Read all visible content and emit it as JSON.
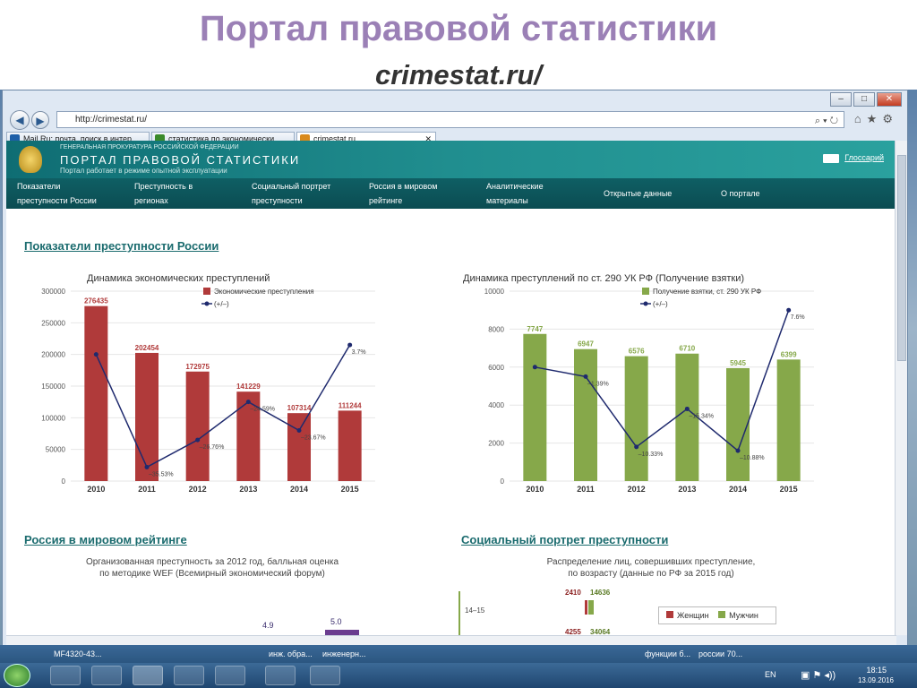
{
  "slide": {
    "title": "Портал правовой статистики",
    "subtitle": "crimestat.ru/"
  },
  "browser": {
    "address": "http://crimestat.ru/",
    "tabs": [
      {
        "label": "Mail.Ru: почта, поиск в интер...",
        "icon_color": "#1e5fa8"
      },
      {
        "label": "статистика по экономически...",
        "icon_color": "#3a8a2a"
      },
      {
        "label": "crimestat.ru",
        "icon_color": "#d98a1c"
      }
    ],
    "tab_close": "✕",
    "window_buttons": [
      "–",
      "□",
      "✕"
    ]
  },
  "portal": {
    "org": "ГЕНЕРАЛЬНАЯ ПРОКУРАТУРА РОССИЙСКОЙ ФЕДЕРАЦИИ",
    "name": "ПОРТАЛ ПРАВОВОЙ СТАТИСТИКИ",
    "note": "Портал работает в режиме опытной эксплуатации",
    "glossary": "Глоссарий",
    "menu": [
      {
        "line1": "Показатели",
        "line2": "преступности России"
      },
      {
        "line1": "Преступность в",
        "line2": "регионах"
      },
      {
        "line1": "Социальный портрет",
        "line2": "преступности"
      },
      {
        "line1": "Россия в мировом",
        "line2": "рейтинге"
      },
      {
        "line1": "Аналитические",
        "line2": "материалы"
      },
      {
        "line1": "Открытые данные",
        "line2": ""
      },
      {
        "line1": "О портале",
        "line2": ""
      }
    ]
  },
  "sections": {
    "indicators": "Показатели преступности России",
    "world_rating": "Россия в мировом рейтинге",
    "social_portrait": "Социальный портрет преступности"
  },
  "world_rating_desc": {
    "line1": "Организованная преступность за 2012 год, балльная оценка",
    "line2": "по методике WEF (Всемирный экономический форум)",
    "values": [
      "4.9",
      "5.0"
    ]
  },
  "social_desc": {
    "line1": "Распределение лиц, совершивших преступление,",
    "line2": "по возрасту (данные по РФ за 2015 год)",
    "age_label": "14–15",
    "values_top": [
      "2410",
      "14636"
    ],
    "values_bottom": [
      "4255",
      "34064"
    ],
    "legend": [
      "Женщин",
      "Мужчин"
    ],
    "colors": {
      "women": "#b03a3a",
      "men": "#86a84a"
    }
  },
  "chart_data": [
    {
      "type": "bar",
      "title": "Динамика экономических преступлений",
      "categories": [
        "2010",
        "2011",
        "2012",
        "2013",
        "2014",
        "2015"
      ],
      "series": [
        {
          "name": "Экономические преступления",
          "values": [
            276435,
            202454,
            172975,
            141229,
            107314,
            111244
          ],
          "color": "#b03a3a"
        },
        {
          "name": "(+/–)",
          "type": "line",
          "values": [
            200000,
            22000,
            65000,
            125000,
            80000,
            215000
          ],
          "labels": [
            "",
            "–35.53%",
            "–26.76%",
            "–24.59%",
            "–23.67%",
            "3.7%"
          ],
          "color": "#1f2a6e"
        }
      ],
      "yticks": [
        0,
        50000,
        100000,
        150000,
        200000,
        250000,
        300000
      ],
      "ylim": [
        0,
        300000
      ]
    },
    {
      "type": "bar",
      "title": "Динамика преступлений по ст. 290 УК РФ (Получение взятки)",
      "categories": [
        "2010",
        "2011",
        "2012",
        "2013",
        "2014",
        "2015"
      ],
      "series": [
        {
          "name": "Получение взятки, ст. 290 УК РФ",
          "values": [
            7747,
            6947,
            6576,
            6710,
            5945,
            6399
          ],
          "color": "#86a84a"
        },
        {
          "name": "(+/–)",
          "type": "line",
          "values": [
            6000,
            5500,
            1800,
            3800,
            1600,
            9000
          ],
          "labels": [
            "",
            "–1.39%",
            "–10.33%",
            "–15.34%",
            "–10.88%",
            "7.6%"
          ],
          "color": "#1f2a6e"
        }
      ],
      "yticks": [
        0,
        2000,
        4000,
        6000,
        8000,
        10000
      ],
      "ylim": [
        0,
        10000
      ]
    }
  ],
  "taskbar": {
    "windows": [
      "MF4320-43...",
      "инж. обра...",
      "инженерн...",
      "функции б...",
      "россии 70..."
    ],
    "lang": "EN",
    "time": "18:15",
    "date": "13.09.2016"
  }
}
